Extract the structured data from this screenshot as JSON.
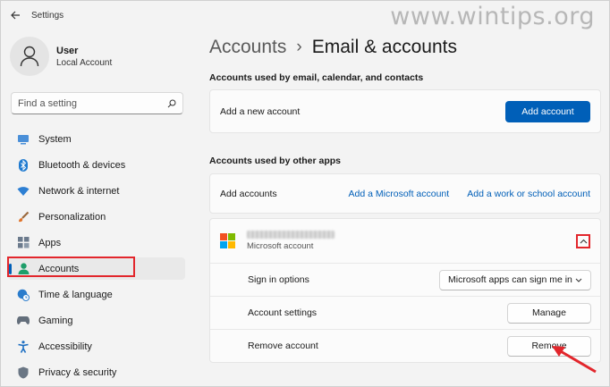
{
  "titlebar": {
    "app_title": "Settings",
    "watermark": "www.wintips.org"
  },
  "profile": {
    "name": "User",
    "subtitle": "Local Account"
  },
  "search": {
    "placeholder": "Find a setting"
  },
  "nav": {
    "items": [
      {
        "label": "System",
        "icon": "monitor-icon"
      },
      {
        "label": "Bluetooth & devices",
        "icon": "bluetooth-icon"
      },
      {
        "label": "Network & internet",
        "icon": "wifi-icon"
      },
      {
        "label": "Personalization",
        "icon": "brush-icon"
      },
      {
        "label": "Apps",
        "icon": "apps-grid-icon"
      },
      {
        "label": "Accounts",
        "icon": "person-icon",
        "active": true
      },
      {
        "label": "Time & language",
        "icon": "globe-clock-icon"
      },
      {
        "label": "Gaming",
        "icon": "gamepad-icon"
      },
      {
        "label": "Accessibility",
        "icon": "accessibility-icon"
      },
      {
        "label": "Privacy & security",
        "icon": "shield-icon"
      }
    ]
  },
  "breadcrumb": {
    "parent": "Accounts",
    "separator": "›",
    "current": "Email & accounts"
  },
  "email_section": {
    "heading": "Accounts used by email, calendar, and contacts",
    "row_label": "Add a new account",
    "button": "Add account"
  },
  "apps_section": {
    "heading": "Accounts used by other apps",
    "row_label": "Add accounts",
    "link_microsoft": "Add a Microsoft account",
    "link_work": "Add a work or school account"
  },
  "account": {
    "type": "Microsoft account",
    "sign_in_label": "Sign in options",
    "sign_in_value": "Microsoft apps can sign me in",
    "settings_label": "Account settings",
    "settings_button": "Manage",
    "remove_label": "Remove account",
    "remove_button": "Remove"
  },
  "colors": {
    "accent": "#005fb8",
    "highlight": "#e2262c",
    "ms_red": "#f25022",
    "ms_green": "#7fba00",
    "ms_blue": "#00a4ef",
    "ms_yellow": "#ffb900"
  }
}
